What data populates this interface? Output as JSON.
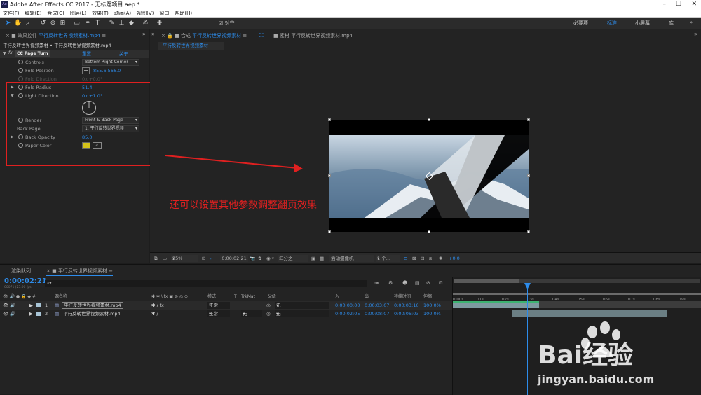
{
  "app": {
    "title": "Adobe After Effects CC 2017 - 无标题项目.aep *",
    "logo": "Ae"
  },
  "menu": [
    "文件(F)",
    "编辑(E)",
    "合成(C)",
    "图层(L)",
    "效果(T)",
    "动画(A)",
    "视图(V)",
    "窗口",
    "帮助(H)"
  ],
  "toolbar": {
    "snap_label": "对齐",
    "workspaces": [
      "必要项",
      "标准",
      "小屏幕",
      "库"
    ],
    "active_workspace": "标准"
  },
  "effects_panel": {
    "tab_label": "效果控件",
    "tab_file": "平行反转世界视频素材.mp4",
    "breadcrumb": "平行反转世界视频素材 • 平行反转世界视频素材.mp4",
    "effect_name": "CC Page Turn",
    "reset": "重置",
    "about": "关于...",
    "props": {
      "controls": {
        "label": "Controls",
        "value": "Bottom Right Corner"
      },
      "fold_position": {
        "label": "Fold Position",
        "value": "855.6,566.0"
      },
      "fold_direction": {
        "label": "Fold Direction",
        "value": "0x +0.0°"
      },
      "fold_radius": {
        "label": "Fold Radius",
        "value": "51.4"
      },
      "light_direction": {
        "label": "Light Direction",
        "value": "0x +1.0°"
      },
      "render": {
        "label": "Render",
        "value": "Front & Back Page"
      },
      "back_page": {
        "label": "Back Page",
        "value": "1. 平行反转世界视频"
      },
      "back_opacity": {
        "label": "Back Opacity",
        "value": "85.0"
      },
      "paper_color": {
        "label": "Paper Color",
        "value": "#d4c21a"
      }
    }
  },
  "comp_panel": {
    "tab_label": "合成",
    "tab_name": "平行反转世界视频素材",
    "footage_tab": "素材 平行反转世界视频素材.mp4",
    "flow_tab": "平行反转世界视频素材",
    "viewbar": {
      "zoom": "25%",
      "timecode": "0:00:02:21",
      "resolution": "二分之一",
      "camera": "活动摄像机",
      "views": "1 个...",
      "exposure": "+0.0"
    }
  },
  "annotation": {
    "text": "还可以设置其他参数调整翻页效果",
    "color": "#e02020"
  },
  "timeline": {
    "render_queue_tab": "渲染队列",
    "comp_tab": "平行反转世界视频素材",
    "timecode": "0:00:02:21",
    "timecode_sub": "00071 (25.00 fps)",
    "columns": {
      "source": "源名称",
      "mode": "模式",
      "t": "T",
      "trkmat": "TrkMat",
      "parent": "父级",
      "in": "入",
      "out": "出",
      "duration": "持续时间",
      "stretch": "伸缩"
    },
    "layers": [
      {
        "num": "1",
        "name": "平行反转世界视频素材.mp4",
        "mode": "正常",
        "trkmat": "",
        "parent": "无",
        "in": "0:00:00:00",
        "out": "0:00:03:07",
        "duration": "0:00:03:16",
        "stretch": "100.0%"
      },
      {
        "num": "2",
        "name": "平行反转世界视频素材.mp4",
        "mode": "正常",
        "trkmat": "无",
        "parent": "无",
        "in": "0:00:02:05",
        "out": "0:00:08:07",
        "duration": "0:00:06:03",
        "stretch": "100.0%"
      }
    ],
    "ruler": [
      "0:00s",
      "01s",
      "02s",
      "03s",
      "04s",
      "05s",
      "06s",
      "07s",
      "08s",
      "09s"
    ]
  },
  "watermark": {
    "brand": "Bai经验",
    "url": "jingyan.baidu.com"
  }
}
